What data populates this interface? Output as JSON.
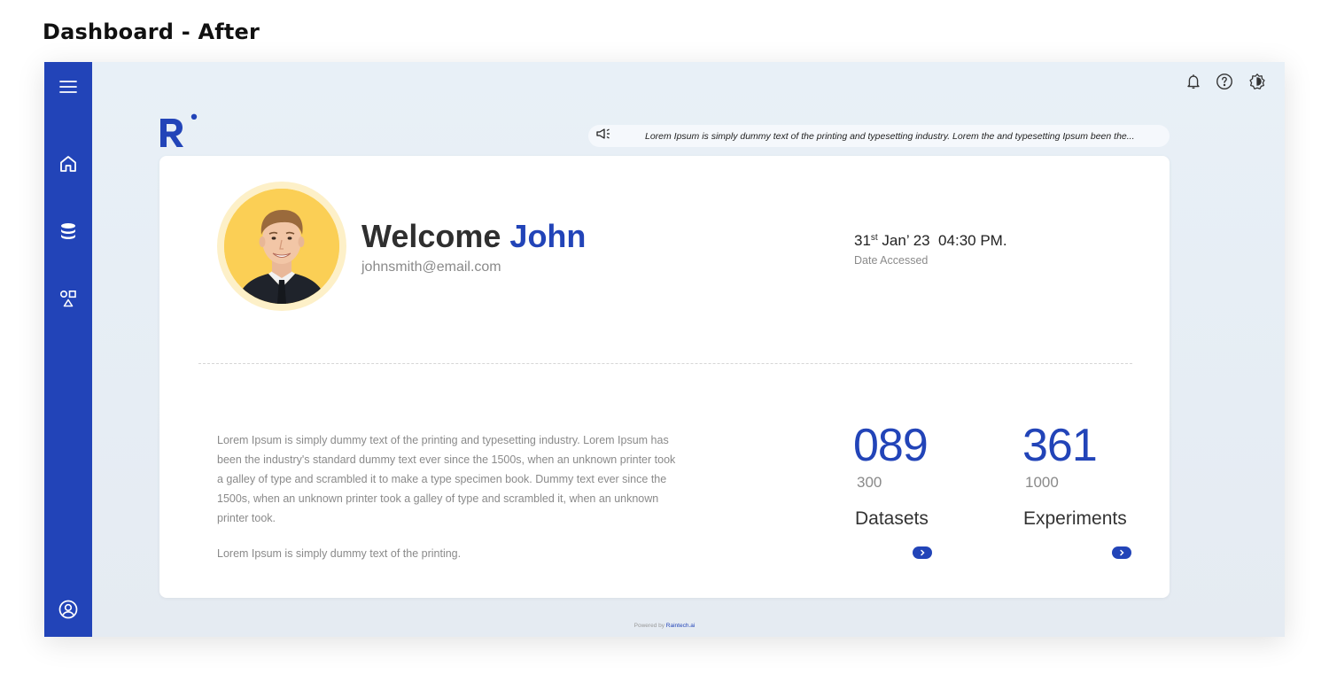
{
  "page_heading": "Dashboard - After",
  "sidebar": {
    "items": [
      {
        "icon": "menu-icon"
      },
      {
        "icon": "home-icon"
      },
      {
        "icon": "database-icon"
      },
      {
        "icon": "shapes-icon"
      },
      {
        "icon": "user-circle-icon"
      }
    ]
  },
  "topbar": {
    "icons": [
      "bell-icon",
      "help-icon",
      "theme-toggle-icon"
    ]
  },
  "announcement": {
    "text": "Lorem Ipsum is simply dummy text of the printing and typesetting industry. Lorem the and typesetting Ipsum been the..."
  },
  "profile": {
    "welcome": "Welcome",
    "name": "John",
    "email": "johnsmith@email.com"
  },
  "access": {
    "day": "31",
    "day_suffix": "st",
    "rest": " Jan’ 23  04:30 PM.",
    "label": "Date Accessed"
  },
  "description": {
    "paragraph": "Lorem Ipsum is simply dummy text of the printing and typesetting industry. Lorem Ipsum has been the industry's standard dummy text ever since the 1500s, when an unknown printer took a galley of type and scrambled it to make a type specimen book. Dummy text ever since the 1500s, when an unknown printer took a galley of type and scrambled it,  when an unknown printer took.",
    "short": "Lorem Ipsum is simply dummy text of the printing."
  },
  "stats": {
    "datasets": {
      "value": "089",
      "total": "300",
      "label": "Datasets"
    },
    "experiments": {
      "value": "361",
      "total": "1000",
      "label": "Experiments"
    }
  },
  "footer": {
    "prefix": "Powered by ",
    "brand": "Raintech.ai"
  },
  "colors": {
    "accent": "#2244b8",
    "avatar_bg": "#fbcf55",
    "avatar_ring": "#fdf0c8"
  }
}
